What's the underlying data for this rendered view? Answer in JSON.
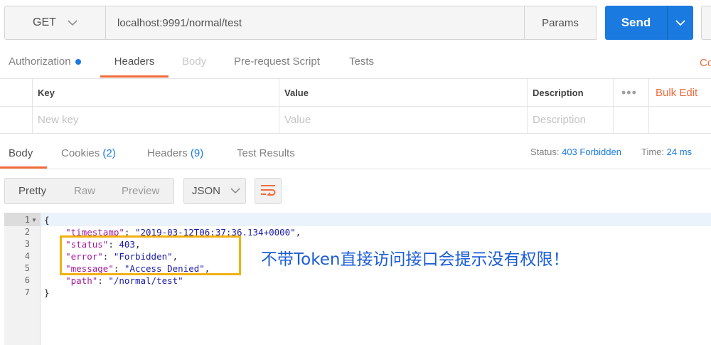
{
  "request": {
    "method": "GET",
    "url": "localhost:9991/normal/test",
    "params_label": "Params",
    "send_label": "Send",
    "cookies_partial": "Co"
  },
  "request_tabs": {
    "authorization": "Authorization",
    "headers": "Headers",
    "body": "Body",
    "prerequest": "Pre-request Script",
    "tests": "Tests"
  },
  "headers_table": {
    "col_key": "Key",
    "col_value": "Value",
    "col_description": "Description",
    "dots": "•••",
    "bulk_edit": "Bulk Edit",
    "new_key_placeholder": "New key",
    "value_placeholder": "Value",
    "description_placeholder": "Description"
  },
  "response_tabs": {
    "body": "Body",
    "cookies": "Cookies",
    "cookies_count": "(2)",
    "headers": "Headers",
    "headers_count": "(9)",
    "test_results": "Test Results"
  },
  "response_meta": {
    "status_label": "Status:",
    "status_value": "403 Forbidden",
    "time_label": "Time:",
    "time_value": "24 ms"
  },
  "format_bar": {
    "pretty": "Pretty",
    "raw": "Raw",
    "preview": "Preview",
    "language": "JSON"
  },
  "code": {
    "line_numbers": [
      "1",
      "2",
      "3",
      "4",
      "5",
      "6",
      "7"
    ],
    "open_brace": "{",
    "close_brace": "}",
    "comma": ",",
    "colon": ": ",
    "lines": [
      {
        "key": "\"timestamp\"",
        "value": "\"2019-03-12T06:37:36.134+0000\"",
        "value_type": "str"
      },
      {
        "key": "\"status\"",
        "value": "403",
        "value_type": "num"
      },
      {
        "key": "\"error\"",
        "value": "\"Forbidden\"",
        "value_type": "str"
      },
      {
        "key": "\"message\"",
        "value": "\"Access Denied\"",
        "value_type": "str"
      },
      {
        "key": "\"path\"",
        "value": "\"/normal/test\"",
        "value_type": "str"
      }
    ]
  },
  "annotation": {
    "text": "不带Token直接访问接口会提示没有权限！",
    "color": "#1a5cd6",
    "box_color": "#f3b111"
  },
  "colors": {
    "accent": "#f26b3a",
    "primary": "#1a7ae0"
  }
}
